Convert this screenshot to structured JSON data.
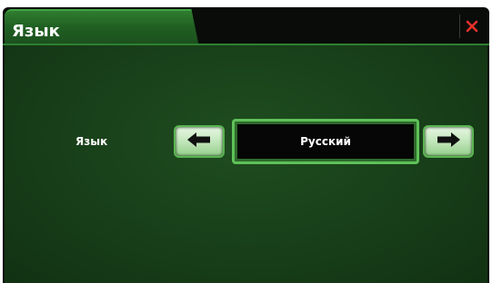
{
  "window": {
    "title": "Язык",
    "close_icon": "close-icon",
    "accent_color": "#2e7f31",
    "close_color": "#e5302a"
  },
  "main": {
    "setting_label": "Язык",
    "selected_value": "Русский",
    "prev_icon": "arrow-left-icon",
    "next_icon": "arrow-right-icon"
  }
}
